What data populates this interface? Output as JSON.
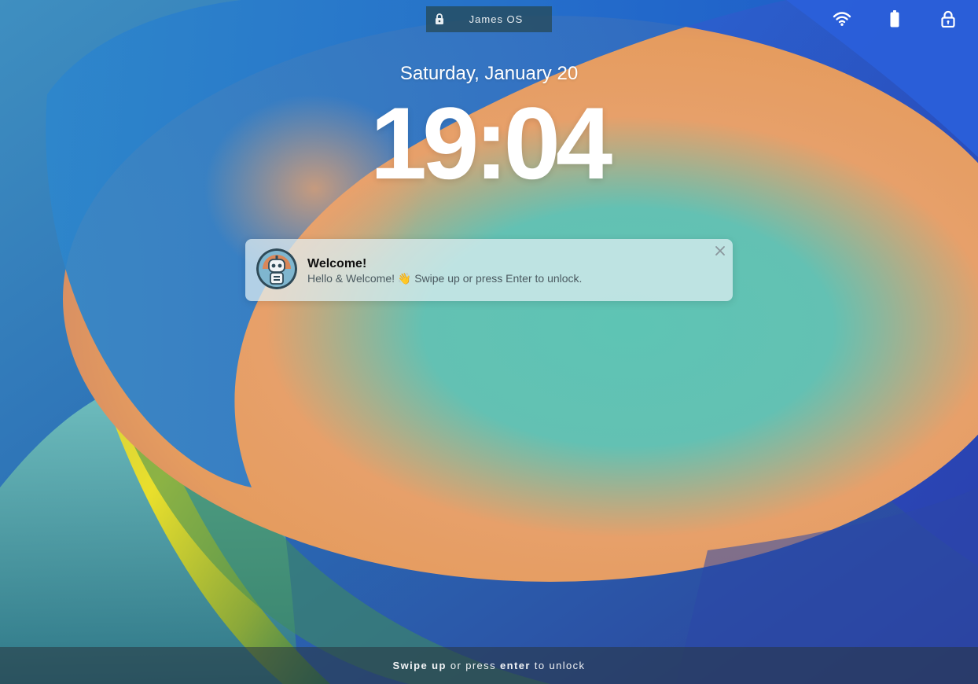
{
  "topbar": {
    "title": "James OS",
    "icons": [
      "lock-icon",
      "wifi-icon",
      "battery-icon",
      "padlock-icon"
    ]
  },
  "lockscreen": {
    "date": "Saturday, January 20",
    "time": "19:04"
  },
  "notification": {
    "title": "Welcome!",
    "body": "Hello & Welcome! 👋 Swipe up or press Enter to unlock.",
    "icon": "robot-avatar",
    "close_icon": "close-icon"
  },
  "unlock_hint": {
    "part1": "Swipe up",
    "part2": " or press ",
    "part3": "enter",
    "part4": " to unlock"
  },
  "colors": {
    "accent_blue": "#2a6fd0",
    "accent_orange": "#e79a63",
    "accent_yellow": "#f2e23a",
    "accent_teal": "#5fbfb0"
  }
}
